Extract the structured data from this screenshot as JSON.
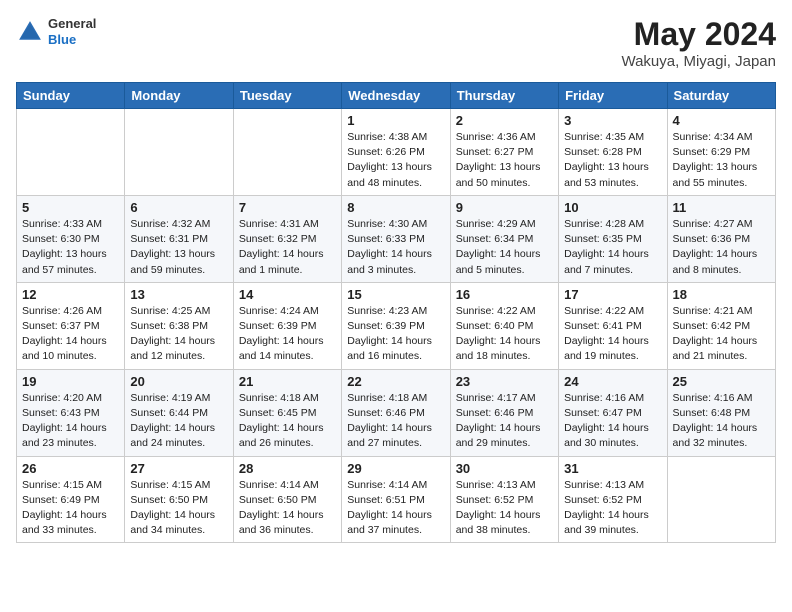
{
  "header": {
    "logo": {
      "general": "General",
      "blue": "Blue"
    },
    "title": "May 2024",
    "location": "Wakuya, Miyagi, Japan"
  },
  "weekdays": [
    "Sunday",
    "Monday",
    "Tuesday",
    "Wednesday",
    "Thursday",
    "Friday",
    "Saturday"
  ],
  "weeks": [
    [
      {
        "day": "",
        "info": ""
      },
      {
        "day": "",
        "info": ""
      },
      {
        "day": "",
        "info": ""
      },
      {
        "day": "1",
        "info": "Sunrise: 4:38 AM\nSunset: 6:26 PM\nDaylight: 13 hours\nand 48 minutes."
      },
      {
        "day": "2",
        "info": "Sunrise: 4:36 AM\nSunset: 6:27 PM\nDaylight: 13 hours\nand 50 minutes."
      },
      {
        "day": "3",
        "info": "Sunrise: 4:35 AM\nSunset: 6:28 PM\nDaylight: 13 hours\nand 53 minutes."
      },
      {
        "day": "4",
        "info": "Sunrise: 4:34 AM\nSunset: 6:29 PM\nDaylight: 13 hours\nand 55 minutes."
      }
    ],
    [
      {
        "day": "5",
        "info": "Sunrise: 4:33 AM\nSunset: 6:30 PM\nDaylight: 13 hours\nand 57 minutes."
      },
      {
        "day": "6",
        "info": "Sunrise: 4:32 AM\nSunset: 6:31 PM\nDaylight: 13 hours\nand 59 minutes."
      },
      {
        "day": "7",
        "info": "Sunrise: 4:31 AM\nSunset: 6:32 PM\nDaylight: 14 hours\nand 1 minute."
      },
      {
        "day": "8",
        "info": "Sunrise: 4:30 AM\nSunset: 6:33 PM\nDaylight: 14 hours\nand 3 minutes."
      },
      {
        "day": "9",
        "info": "Sunrise: 4:29 AM\nSunset: 6:34 PM\nDaylight: 14 hours\nand 5 minutes."
      },
      {
        "day": "10",
        "info": "Sunrise: 4:28 AM\nSunset: 6:35 PM\nDaylight: 14 hours\nand 7 minutes."
      },
      {
        "day": "11",
        "info": "Sunrise: 4:27 AM\nSunset: 6:36 PM\nDaylight: 14 hours\nand 8 minutes."
      }
    ],
    [
      {
        "day": "12",
        "info": "Sunrise: 4:26 AM\nSunset: 6:37 PM\nDaylight: 14 hours\nand 10 minutes."
      },
      {
        "day": "13",
        "info": "Sunrise: 4:25 AM\nSunset: 6:38 PM\nDaylight: 14 hours\nand 12 minutes."
      },
      {
        "day": "14",
        "info": "Sunrise: 4:24 AM\nSunset: 6:39 PM\nDaylight: 14 hours\nand 14 minutes."
      },
      {
        "day": "15",
        "info": "Sunrise: 4:23 AM\nSunset: 6:39 PM\nDaylight: 14 hours\nand 16 minutes."
      },
      {
        "day": "16",
        "info": "Sunrise: 4:22 AM\nSunset: 6:40 PM\nDaylight: 14 hours\nand 18 minutes."
      },
      {
        "day": "17",
        "info": "Sunrise: 4:22 AM\nSunset: 6:41 PM\nDaylight: 14 hours\nand 19 minutes."
      },
      {
        "day": "18",
        "info": "Sunrise: 4:21 AM\nSunset: 6:42 PM\nDaylight: 14 hours\nand 21 minutes."
      }
    ],
    [
      {
        "day": "19",
        "info": "Sunrise: 4:20 AM\nSunset: 6:43 PM\nDaylight: 14 hours\nand 23 minutes."
      },
      {
        "day": "20",
        "info": "Sunrise: 4:19 AM\nSunset: 6:44 PM\nDaylight: 14 hours\nand 24 minutes."
      },
      {
        "day": "21",
        "info": "Sunrise: 4:18 AM\nSunset: 6:45 PM\nDaylight: 14 hours\nand 26 minutes."
      },
      {
        "day": "22",
        "info": "Sunrise: 4:18 AM\nSunset: 6:46 PM\nDaylight: 14 hours\nand 27 minutes."
      },
      {
        "day": "23",
        "info": "Sunrise: 4:17 AM\nSunset: 6:46 PM\nDaylight: 14 hours\nand 29 minutes."
      },
      {
        "day": "24",
        "info": "Sunrise: 4:16 AM\nSunset: 6:47 PM\nDaylight: 14 hours\nand 30 minutes."
      },
      {
        "day": "25",
        "info": "Sunrise: 4:16 AM\nSunset: 6:48 PM\nDaylight: 14 hours\nand 32 minutes."
      }
    ],
    [
      {
        "day": "26",
        "info": "Sunrise: 4:15 AM\nSunset: 6:49 PM\nDaylight: 14 hours\nand 33 minutes."
      },
      {
        "day": "27",
        "info": "Sunrise: 4:15 AM\nSunset: 6:50 PM\nDaylight: 14 hours\nand 34 minutes."
      },
      {
        "day": "28",
        "info": "Sunrise: 4:14 AM\nSunset: 6:50 PM\nDaylight: 14 hours\nand 36 minutes."
      },
      {
        "day": "29",
        "info": "Sunrise: 4:14 AM\nSunset: 6:51 PM\nDaylight: 14 hours\nand 37 minutes."
      },
      {
        "day": "30",
        "info": "Sunrise: 4:13 AM\nSunset: 6:52 PM\nDaylight: 14 hours\nand 38 minutes."
      },
      {
        "day": "31",
        "info": "Sunrise: 4:13 AM\nSunset: 6:52 PM\nDaylight: 14 hours\nand 39 minutes."
      },
      {
        "day": "",
        "info": ""
      }
    ]
  ]
}
